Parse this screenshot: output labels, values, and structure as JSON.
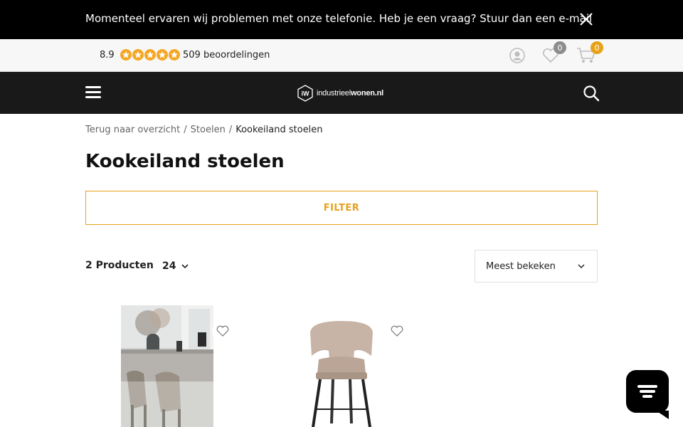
{
  "announcement": {
    "text": "Momenteel ervaren wij problemen met onze telefonie. Heb je een vraag? Stuur dan een e-mail"
  },
  "rating": {
    "score": "8.9",
    "reviews": "509 beoordelingen",
    "stars": 5
  },
  "header_icons": {
    "wishlist_count": "0",
    "cart_count": "0"
  },
  "logo": {
    "text_light": "industrieel",
    "text_bold": "wonen.nl",
    "mark": "iW"
  },
  "breadcrumb": {
    "back": "Terug naar overzicht",
    "parent": "Stoelen",
    "current": "Kookeiland stoelen",
    "separator": "/"
  },
  "page": {
    "title": "Kookeiland stoelen"
  },
  "filter": {
    "label": "FILTER"
  },
  "listing": {
    "count": "2 Producten",
    "per_page": "24",
    "sort_selected": "Meest bekeken"
  },
  "colors": {
    "accent": "#e6a21a",
    "header_bg": "#191919",
    "topbar_bg": "#000000"
  }
}
